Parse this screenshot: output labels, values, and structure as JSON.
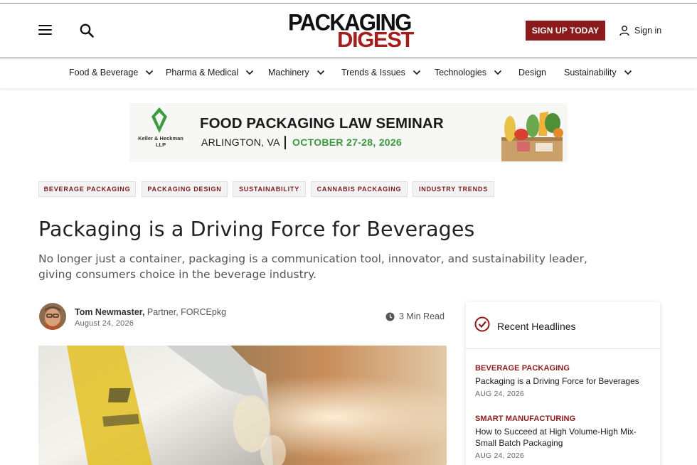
{
  "header": {
    "logo_top": "PACKAGING",
    "logo_bottom": "DIGEST",
    "signup_label": "SIGN UP TODAY",
    "signin_label": "Sign in"
  },
  "nav": {
    "items": [
      {
        "label": "Food & Beverage",
        "dropdown": true
      },
      {
        "label": "Pharma & Medical",
        "dropdown": true
      },
      {
        "label": "Machinery",
        "dropdown": true
      },
      {
        "label": "Trends & Issues",
        "dropdown": true
      },
      {
        "label": "Technologies",
        "dropdown": true
      },
      {
        "label": "Design",
        "dropdown": false
      },
      {
        "label": "Sustainability",
        "dropdown": true
      }
    ]
  },
  "ad": {
    "sponsor": "Keller & Heckman LLP",
    "title": "FOOD PACKAGING LAW SEMINAR",
    "location": "ARLINGTON, VA",
    "dates": "OCTOBER 27-28, 2026"
  },
  "article": {
    "tags": [
      "BEVERAGE PACKAGING",
      "PACKAGING DESIGN",
      "SUSTAINABILITY",
      "CANNABIS PACKAGING",
      "INDUSTRY TRENDS"
    ],
    "title": "Packaging is a Driving Force for Beverages",
    "subtitle": "No longer just a container, packaging is a communication tool, innovator, and sustainability leader, giving consumers choice in the beverage industry.",
    "author_name": "Tom Newmaster,",
    "author_role": " Partner, FORCEpkg",
    "date": "August 24, 2026",
    "read_time": "3 Min Read"
  },
  "sidebar": {
    "title": "Recent Headlines",
    "items": [
      {
        "category": "BEVERAGE PACKAGING",
        "headline": "Packaging is a Driving Force for Beverages",
        "date": "AUG 24, 2026"
      },
      {
        "category": "SMART MANUFACTURING",
        "headline": "How to Succeed at High Volume-High Mix-Small Batch Packaging",
        "date": "AUG 24, 2026"
      }
    ]
  },
  "colors": {
    "brand_red": "#8b1a1a",
    "accent_green": "#3b9a3d"
  }
}
